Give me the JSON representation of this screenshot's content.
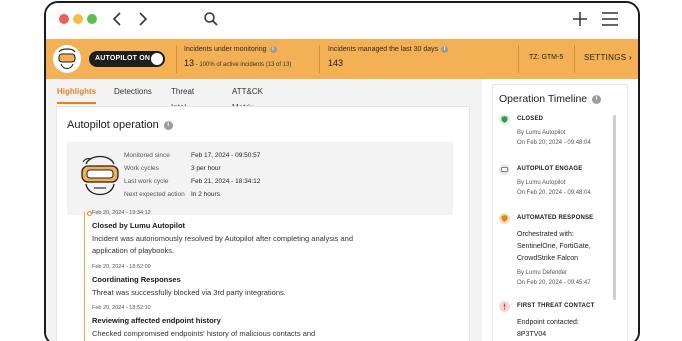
{
  "window": {
    "colors": {
      "banner": "#f3b055",
      "accent": "#e6821e",
      "close": "#ee5f57",
      "minimize": "#f4be3e",
      "zoom": "#5bc04f"
    },
    "icons": [
      "chevron-left-icon",
      "chevron-right-icon",
      "search-icon",
      "plus-icon",
      "hamburger-menu-icon"
    ]
  },
  "banner": {
    "autopilot_label": "AUTOPILOT ON",
    "monitoring": {
      "label": "Incidents under monitoring",
      "value": "13",
      "detail": " - 100% of active incidents (13 of 13)"
    },
    "managed": {
      "label": "Incidents managed the last 30 days",
      "value": "143"
    },
    "timezone": "TZ: GTM-5",
    "settings": "SETTINGS",
    "settings_arrow": "›"
  },
  "tabs": [
    "Highlights",
    "Detections",
    "Threat Intel",
    "ATT&CK Matrix"
  ],
  "autopilot_card": {
    "title": "Autopilot operation",
    "details": [
      {
        "key": "Monitored since",
        "value": "Feb 17, 2024 - 09:50:57"
      },
      {
        "key": "Work cycles",
        "value": "3 per hour"
      },
      {
        "key": "Last work cycle",
        "value": "Feb 21, 2024 - 18:34:12"
      },
      {
        "key": "Next expected action",
        "value": "In 2 hours"
      }
    ],
    "events": [
      {
        "time": "Feb 20, 2024 - 19:34:12",
        "title": "Closed by Lumu Autopilot",
        "desc": "Incident was autonomously resolved by Autopilot after completing analysis and application of playbooks."
      },
      {
        "time": "Feb 20, 2024 - 18:52:09",
        "title": "Coordinating Responses",
        "desc": "Threat was successfully blocked via 3rd party integrations."
      },
      {
        "time": "Feb 20, 2024 - 18:52:10",
        "title": "Reviewing affected endpoint history",
        "desc": "Checked compromised endpoints' history of malicious contacts and"
      }
    ]
  },
  "operation_timeline": {
    "title": "Operation Timeline",
    "events": [
      {
        "title": "CLOSED",
        "by": "By Lumu Autopilot",
        "on": "On Feb 20, 2024 - 09:48:04"
      },
      {
        "title": "AUTOPILOT ENGAGE",
        "by": "By Lumu Autopilot",
        "on": "On Feb 20, 2024 - 09:48:04"
      },
      {
        "title": "AUTOMATED RESPONSE",
        "body": [
          "Orchestrated with:",
          "SentinelOne, FortiGate,",
          "CrowdStrike Falcon"
        ],
        "by": "By Lumu Defender",
        "on": "On Feb 20, 2024 - 09:45:47"
      },
      {
        "title": "FIRST THREAT CONTACT",
        "body": [
          "Endpoint contacted:",
          "8P3TV04"
        ]
      }
    ]
  }
}
